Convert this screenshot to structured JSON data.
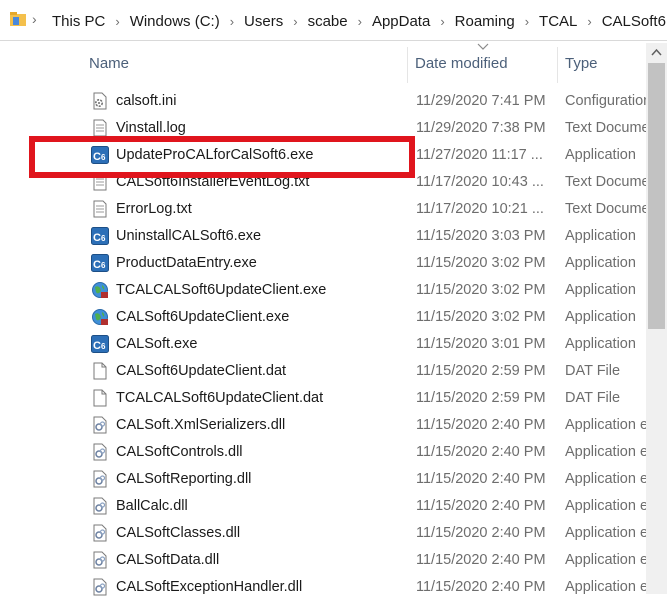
{
  "breadcrumb": [
    "This PC",
    "Windows (C:)",
    "Users",
    "scabe",
    "AppData",
    "Roaming",
    "TCAL",
    "CALSoft6"
  ],
  "columns": {
    "name": "Name",
    "date": "Date modified",
    "type": "Type"
  },
  "highlight_color": "#e0151d",
  "files": [
    {
      "name": "calsoft.ini",
      "date": "11/29/2020 7:41 PM",
      "type": "Configuration",
      "icon": "settings-file-icon"
    },
    {
      "name": "Vinstall.log",
      "date": "11/29/2020 7:38 PM",
      "type": "Text Document",
      "icon": "text-file-icon"
    },
    {
      "name": "UpdateProCALforCalSoft6.exe",
      "date": "11/27/2020 11:17 ...",
      "type": "Application",
      "icon": "calsoft-app-icon"
    },
    {
      "name": "CALSoft6InstallerEventLog.txt",
      "date": "11/17/2020 10:43 ...",
      "type": "Text Document",
      "icon": "text-file-icon"
    },
    {
      "name": "ErrorLog.txt",
      "date": "11/17/2020 10:21 ...",
      "type": "Text Document",
      "icon": "text-file-icon"
    },
    {
      "name": "UninstallCALSoft6.exe",
      "date": "11/15/2020 3:03 PM",
      "type": "Application",
      "icon": "calsoft-app-icon"
    },
    {
      "name": "ProductDataEntry.exe",
      "date": "11/15/2020 3:02 PM",
      "type": "Application",
      "icon": "calsoft-app-icon"
    },
    {
      "name": "TCALCALSoft6UpdateClient.exe",
      "date": "11/15/2020 3:02 PM",
      "type": "Application",
      "icon": "globe-app-icon"
    },
    {
      "name": "CALSoft6UpdateClient.exe",
      "date": "11/15/2020 3:02 PM",
      "type": "Application",
      "icon": "globe-app-icon"
    },
    {
      "name": "CALSoft.exe",
      "date": "11/15/2020 3:01 PM",
      "type": "Application",
      "icon": "calsoft-app-icon"
    },
    {
      "name": "CALSoft6UpdateClient.dat",
      "date": "11/15/2020 2:59 PM",
      "type": "DAT File",
      "icon": "blank-file-icon"
    },
    {
      "name": "TCALCALSoft6UpdateClient.dat",
      "date": "11/15/2020 2:59 PM",
      "type": "DAT File",
      "icon": "blank-file-icon"
    },
    {
      "name": "CALSoft.XmlSerializers.dll",
      "date": "11/15/2020 2:40 PM",
      "type": "Application extension",
      "icon": "dll-file-icon"
    },
    {
      "name": "CALSoftControls.dll",
      "date": "11/15/2020 2:40 PM",
      "type": "Application extension",
      "icon": "dll-file-icon"
    },
    {
      "name": "CALSoftReporting.dll",
      "date": "11/15/2020 2:40 PM",
      "type": "Application extension",
      "icon": "dll-file-icon"
    },
    {
      "name": "BallCalc.dll",
      "date": "11/15/2020 2:40 PM",
      "type": "Application extension",
      "icon": "dll-file-icon"
    },
    {
      "name": "CALSoftClasses.dll",
      "date": "11/15/2020 2:40 PM",
      "type": "Application extension",
      "icon": "dll-file-icon"
    },
    {
      "name": "CALSoftData.dll",
      "date": "11/15/2020 2:40 PM",
      "type": "Application extension",
      "icon": "dll-file-icon"
    },
    {
      "name": "CALSoftExceptionHandler.dll",
      "date": "11/15/2020 2:40 PM",
      "type": "Application extension",
      "icon": "dll-file-icon"
    }
  ]
}
